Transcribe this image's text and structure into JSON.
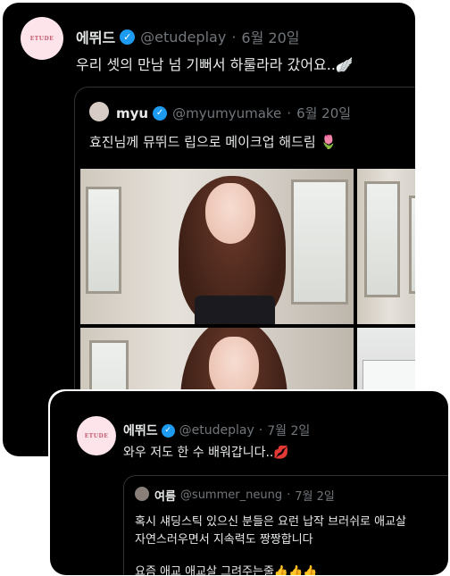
{
  "post": {
    "author_name": "에뛰드",
    "avatar_text": "ETUDE",
    "handle": "@etudeplay",
    "separator": "·",
    "date": "6월 20일",
    "text": "우리 셋의 만남 넘 기뻐서 하룰라라 갔어요..🪽",
    "quote": {
      "author_name": "myu",
      "handle": "@myumyumake",
      "date": "6월 20일",
      "text": "효진님께 뮤뛰드 립으로 메이크업 해드림 🌷"
    }
  },
  "reply": {
    "author_name": "에뛰드",
    "avatar_text": "ETUDE",
    "handle": "@etudeplay",
    "separator": "·",
    "date": "7월 2일",
    "text": "와우 저도 한 수 배워갑니다..💋",
    "quote": {
      "author_name": "여름",
      "handle": "@summer_neung",
      "date": "7월 2일",
      "lines": [
        "혹시 섀딩스틱 있으신 분들은 요런 납작 브러쉬로 애교살",
        "자연스러우면서 지속력도 짱짱합니다",
        "요즘 애교 애교살 그려주는줄👍👍👍"
      ]
    }
  },
  "colors": {
    "background": "#000000",
    "text": "#e7e9ea",
    "muted": "#71767b",
    "verified": "#1d9bf0",
    "brand_avatar": "#fde4ea"
  }
}
